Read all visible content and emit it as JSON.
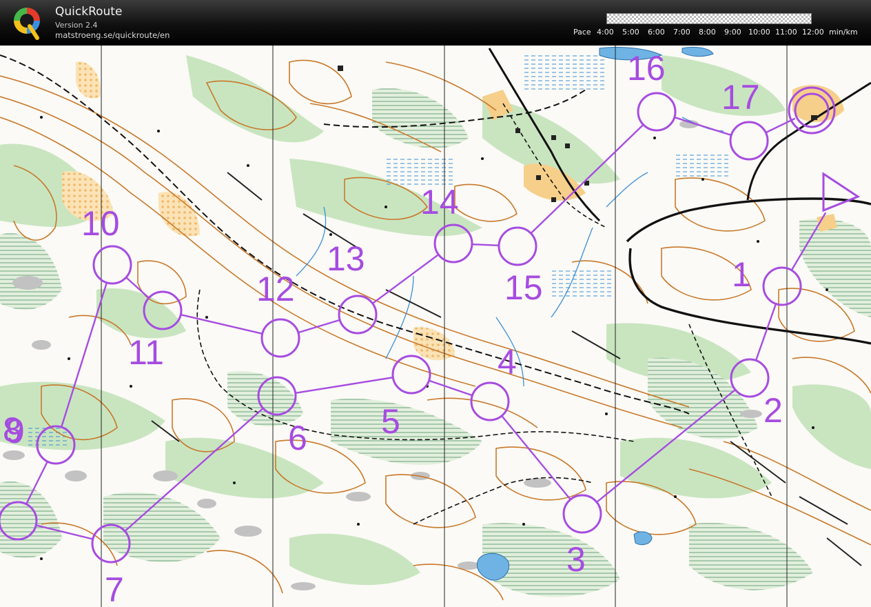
{
  "app": {
    "title": "QuickRoute",
    "version": "Version 2.4",
    "url": "matstroeng.se/quickroute/en",
    "logo_letter": "Q"
  },
  "pace": {
    "label": "Pace",
    "ticks": [
      "4:00",
      "5:00",
      "6:00",
      "7:00",
      "8:00",
      "9:00",
      "10:00",
      "11:00",
      "12:00"
    ],
    "unit": "min/km"
  },
  "colors": {
    "header_bg": "#1a1a1a",
    "course": "#a64ce0",
    "vegetation_green": "#c5e3bd",
    "open_land_yellow": "#f7d59b",
    "contour_brown": "#c8782a",
    "water_blue": "#6fb3e4",
    "rock_grey": "#b4b4b4"
  },
  "map": {
    "controls": [
      {
        "number": "1"
      },
      {
        "number": "2"
      },
      {
        "number": "3"
      },
      {
        "number": "4"
      },
      {
        "number": "5"
      },
      {
        "number": "6"
      },
      {
        "number": "7"
      },
      {
        "number": "8"
      },
      {
        "number": "9"
      },
      {
        "number": "10"
      },
      {
        "number": "11"
      },
      {
        "number": "12"
      },
      {
        "number": "13"
      },
      {
        "number": "14"
      },
      {
        "number": "15"
      },
      {
        "number": "16"
      },
      {
        "number": "17"
      }
    ]
  }
}
